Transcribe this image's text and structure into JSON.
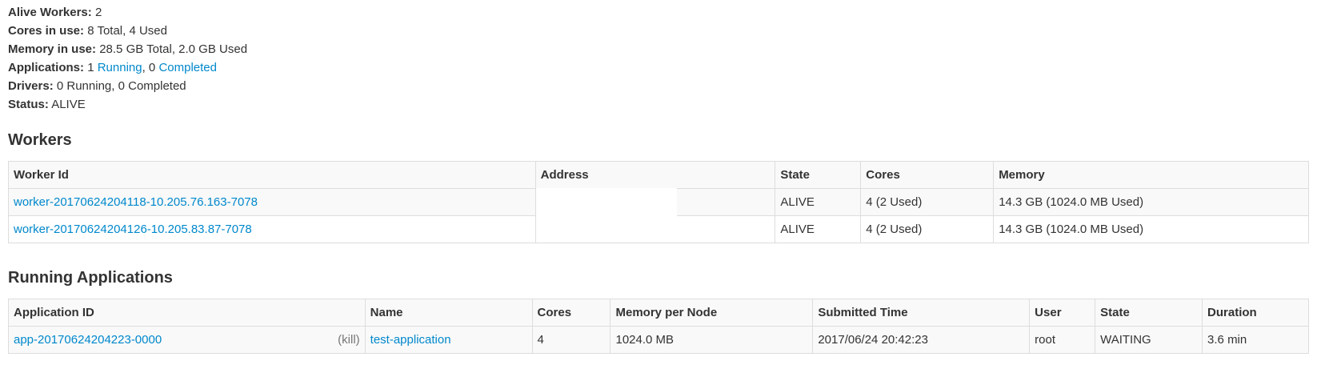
{
  "summary": {
    "alive_workers_label": "Alive Workers:",
    "alive_workers_value": "2",
    "cores_label": "Cores in use:",
    "cores_value": "8 Total, 4 Used",
    "memory_label": "Memory in use:",
    "memory_value": "28.5 GB Total, 2.0 GB Used",
    "apps_label": "Applications:",
    "apps_running_count": "1",
    "apps_running_link": "Running",
    "apps_sep": ", 0",
    "apps_completed_link": "Completed",
    "drivers_label": "Drivers:",
    "drivers_value": "0 Running, 0 Completed",
    "status_label": "Status:",
    "status_value": "ALIVE"
  },
  "workers": {
    "heading": "Workers",
    "columns": [
      "Worker Id",
      "Address",
      "State",
      "Cores",
      "Memory"
    ],
    "rows": [
      {
        "id": "worker-20170624204118-10.205.76.163-7078",
        "address": "",
        "state": "ALIVE",
        "cores": "4 (2 Used)",
        "memory": "14.3 GB (1024.0 MB Used)"
      },
      {
        "id": "worker-20170624204126-10.205.83.87-7078",
        "address": "",
        "state": "ALIVE",
        "cores": "4 (2 Used)",
        "memory": "14.3 GB (1024.0 MB Used)"
      }
    ]
  },
  "running_apps": {
    "heading": "Running Applications",
    "columns": [
      "Application ID",
      "Name",
      "Cores",
      "Memory per Node",
      "Submitted Time",
      "User",
      "State",
      "Duration"
    ],
    "rows": [
      {
        "app_id": "app-20170624204223-0000",
        "kill_open": "(",
        "kill_link": "kill",
        "kill_close": ")",
        "name": "test-application",
        "cores": "4",
        "memory_per_node": "1024.0 MB",
        "submitted": "2017/06/24 20:42:23",
        "user": "root",
        "state": "WAITING",
        "duration": "3.6 min"
      }
    ]
  }
}
